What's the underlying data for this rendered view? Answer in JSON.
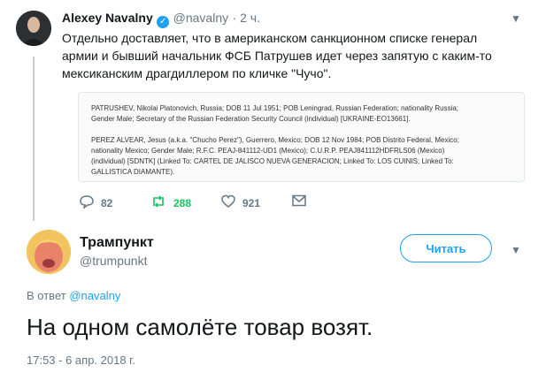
{
  "tweet": {
    "author_name": "Alexey Navalny",
    "handle": "@navalny",
    "time": "· 2 ч.",
    "text_line1": "Отдельно доставляет, что в американском санкционном списке генерал",
    "text_line2": "армии и бывший начальник ФСБ Патрушев идет через запятую с каким-то",
    "text_line3": "мексиканским драгдиллером по кличке \"Чучо\".",
    "card": {
      "line1": "PATRUSHEV, Nikolai Platonovich, Russia; DOB 11 Jul 1951; POB Leningrad, Russian Federation; nationality Russia;",
      "line2": "Gender Male; Secretary of the Russian Federation Security Council (individual) [UKRAINE-EO13661].",
      "line3": "PEREZ ALVEAR, Jesus (a.k.a. \"Chucho Perez\"), Guerrero, Mexico; DOB 12 Nov 1984; POB Distrito Federal, Mexico;",
      "line4": "nationality Mexico; Gender Male; R.F.C. PEAJ-841112-UD1 (Mexico); C.U.R.P. PEAJ841112HDFRLS06 (Mexico)",
      "line5": "(individual) [SDNTK] (Linked To: CARTEL DE JALISCO NUEVA GENERACION; Linked To: LOS CUINIS; Linked To:",
      "line6": "GALLISTICA DIAMANTE)."
    },
    "replies": "82",
    "retweets": "288",
    "likes": "921"
  },
  "reply": {
    "author_name": "Трампункт",
    "handle": "@trumpunkt",
    "follow_label": "Читать",
    "in_reply_prefix": "В ответ",
    "in_reply_handle": "@navalny",
    "text": "На одном самолёте товар возят.",
    "timestamp": "17:53 - 6 апр. 2018 г."
  },
  "colors": {
    "accent": "#1da1f2",
    "retweet_green": "#17bf63",
    "muted": "#657786"
  },
  "icons": [
    "verified-icon",
    "chevron-down-icon",
    "reply-icon",
    "retweet-icon",
    "like-icon",
    "message-icon"
  ]
}
